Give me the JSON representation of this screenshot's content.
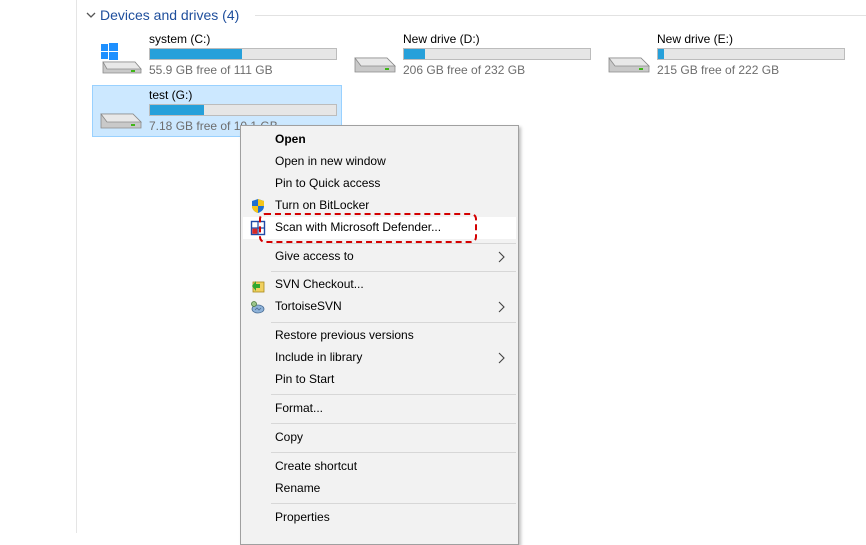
{
  "group": {
    "title": "Devices and drives (4)"
  },
  "drives": [
    {
      "name": "system (C:)",
      "free_text": "55.9 GB free of 111 GB",
      "used_fraction": 0.496,
      "icon": "windows-drive-icon"
    },
    {
      "name": "New drive (D:)",
      "free_text": "206 GB free of 232 GB",
      "used_fraction": 0.112,
      "icon": "hard-drive-icon"
    },
    {
      "name": "New drive (E:)",
      "free_text": "215 GB free of 222 GB",
      "used_fraction": 0.032,
      "icon": "hard-drive-icon"
    },
    {
      "name": "test (G:)",
      "free_text": "7.18 GB free of 10.1 GB",
      "used_fraction": 0.29,
      "icon": "hard-drive-icon",
      "selected": true
    }
  ],
  "menu": {
    "open": "Open",
    "open_new_window": "Open in new window",
    "pin_quick_access": "Pin to Quick access",
    "turn_on_bitlocker": "Turn on BitLocker",
    "scan_defender": "Scan with Microsoft Defender...",
    "give_access": "Give access to",
    "svn_checkout": "SVN Checkout...",
    "tortoise_svn": "TortoiseSVN",
    "restore_versions": "Restore previous versions",
    "include_library": "Include in library",
    "pin_start": "Pin to Start",
    "format": "Format...",
    "copy": "Copy",
    "create_shortcut": "Create shortcut",
    "rename": "Rename",
    "properties": "Properties"
  },
  "colors": {
    "bar_fill": "#26a0da",
    "selection": "#cce8ff",
    "highlight": "#d40000",
    "group_title": "#1e4e9c"
  }
}
